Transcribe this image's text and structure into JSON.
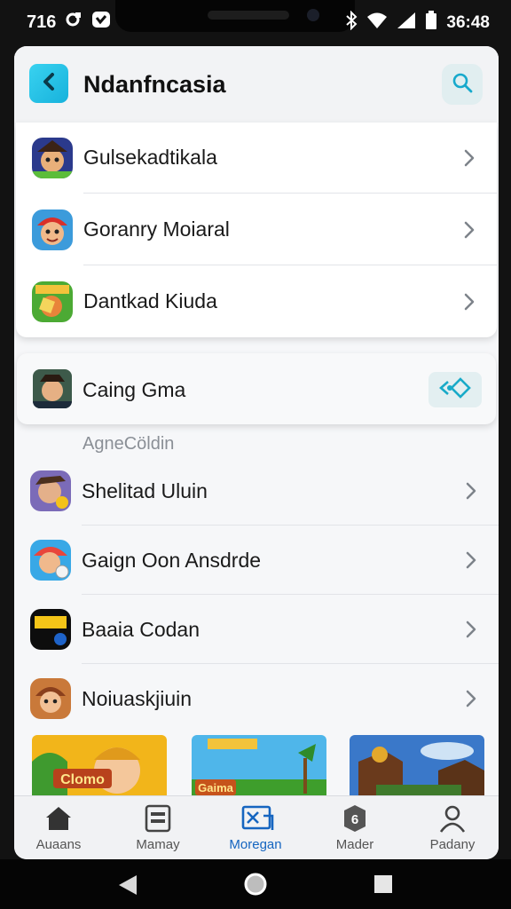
{
  "status": {
    "left_text": "716",
    "time": "36:48"
  },
  "header": {
    "title": "Ndanfncasia"
  },
  "card_items": [
    {
      "label": "Gulsekadtikala"
    },
    {
      "label": "Goranry Moiaral"
    },
    {
      "label": "Dantkad Kiuda"
    }
  ],
  "featured": {
    "label": "Caing Gma"
  },
  "section": {
    "title": "AgneCöldin"
  },
  "list_items": [
    {
      "label": "Shelitad Uluin"
    },
    {
      "label": "Gaign Oon Ansdrde"
    },
    {
      "label": "Baaia Codan"
    },
    {
      "label": "Noiuaskjiuin"
    }
  ],
  "banners": [
    {
      "text": "Clomo"
    },
    {
      "text": "Gaima"
    },
    {
      "text": ""
    }
  ],
  "nav": [
    {
      "label": "Auaans"
    },
    {
      "label": "Mamay"
    },
    {
      "label": "Moregan"
    },
    {
      "label": "Mader"
    },
    {
      "label": "Padany"
    }
  ],
  "colors": {
    "accent": "#1ab6df",
    "active_nav": "#1565c0",
    "text": "#1a1a1a"
  }
}
